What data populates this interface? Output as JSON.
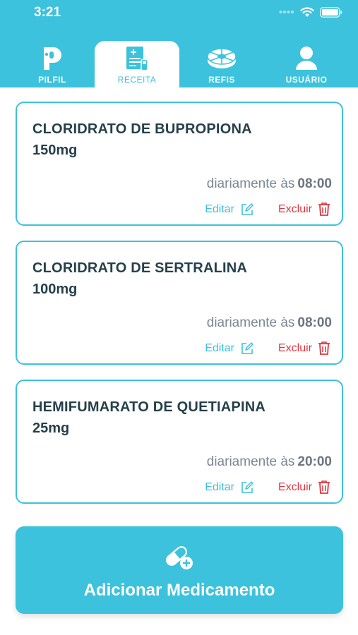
{
  "status_bar": {
    "time": "3:21"
  },
  "tabs": [
    {
      "label": "PILFIL",
      "icon": "pilfil-logo-icon",
      "active": false
    },
    {
      "label": "RECEITA",
      "icon": "prescription-icon",
      "active": true
    },
    {
      "label": "REFIS",
      "icon": "pill-box-icon",
      "active": false
    },
    {
      "label": "USUÁRIO",
      "icon": "user-icon",
      "active": false
    }
  ],
  "medications": [
    {
      "name": "CLORIDRATO DE BUPROPIONA",
      "dose": "150mg",
      "schedule_prefix": "diariamente às",
      "time": "08:00",
      "edit_label": "Editar",
      "delete_label": "Excluir"
    },
    {
      "name": "CLORIDRATO DE SERTRALINA",
      "dose": "100mg",
      "schedule_prefix": "diariamente às",
      "time": "08:00",
      "edit_label": "Editar",
      "delete_label": "Excluir"
    },
    {
      "name": "HEMIFUMARATO DE QUETIAPINA",
      "dose": "25mg",
      "schedule_prefix": "diariamente às",
      "time": "20:00",
      "edit_label": "Editar",
      "delete_label": "Excluir"
    }
  ],
  "add_button": {
    "label": "Adicionar Medicamento",
    "icon": "add-pill-icon"
  },
  "colors": {
    "accent": "#3cc2dc",
    "text_dark": "#25404a",
    "danger": "#e0353f",
    "muted": "#7b8794"
  }
}
